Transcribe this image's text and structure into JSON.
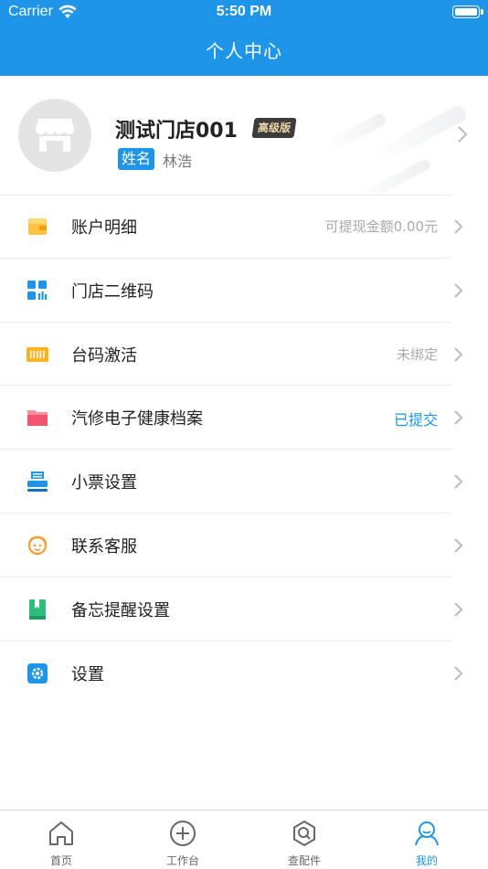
{
  "status_bar": {
    "carrier": "Carrier",
    "time": "5:50 PM"
  },
  "header": {
    "title": "个人中心"
  },
  "profile": {
    "store_name": "测试门店001",
    "level_badge": "高级版",
    "name_tag": "姓名",
    "person_name": "林浩"
  },
  "menu": [
    {
      "label": "账户明细",
      "value": "可提现金额0.00元",
      "icon": "wallet-icon"
    },
    {
      "label": "门店二维码",
      "value": "",
      "icon": "qrcode-icon"
    },
    {
      "label": "台码激活",
      "value": "未绑定",
      "icon": "barcode-icon"
    },
    {
      "label": "汽修电子健康档案",
      "value": "已提交",
      "icon": "folder-icon"
    },
    {
      "label": "小票设置",
      "value": "",
      "icon": "printer-icon"
    },
    {
      "label": "联系客服",
      "value": "",
      "icon": "customer-service-icon"
    },
    {
      "label": "备忘提醒设置",
      "value": "",
      "icon": "memo-book-icon"
    },
    {
      "label": "设置",
      "value": "",
      "icon": "settings-gear-icon"
    }
  ],
  "tabs": [
    {
      "label": "首页",
      "icon": "home-icon",
      "active": false
    },
    {
      "label": "工作台",
      "icon": "plus-circle-icon",
      "active": false
    },
    {
      "label": "查配件",
      "icon": "search-parts-icon",
      "active": false
    },
    {
      "label": "我的",
      "icon": "user-icon",
      "active": true
    }
  ],
  "colors": {
    "brand_blue": "#1e95e8",
    "muted_text": "#aaaaaa",
    "badge_dark": "#3c3c3c",
    "badge_gold": "#f0d8a8"
  }
}
